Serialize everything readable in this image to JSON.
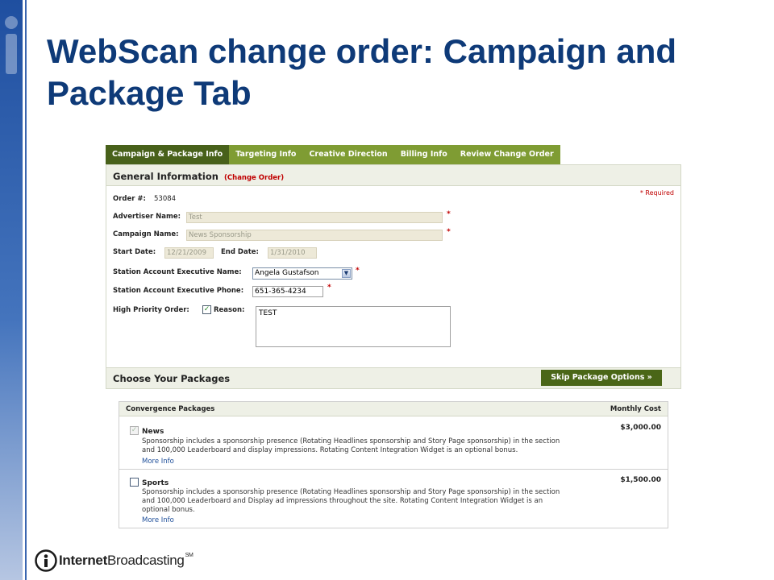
{
  "slide": {
    "title": "WebScan change order: Campaign and Package Tab"
  },
  "tabs": [
    {
      "label": "Campaign & Package Info",
      "active": true
    },
    {
      "label": "Targeting Info"
    },
    {
      "label": "Creative Direction"
    },
    {
      "label": "Billing Info"
    },
    {
      "label": "Review Change Order"
    }
  ],
  "general": {
    "title": "General Information",
    "subtitle": "(Change Order)",
    "required_note": "* Required",
    "order_label": "Order #:",
    "order_value": "53084",
    "advertiser_label": "Advertiser Name:",
    "advertiser_value": "Test",
    "campaign_label": "Campaign Name:",
    "campaign_value": "News Sponsorship",
    "start_label": "Start Date:",
    "start_value": "12/21/2009",
    "end_label": "End Date:",
    "end_value": "1/31/2010",
    "sae_name_label": "Station Account Executive Name:",
    "sae_name_value": "Angela Gustafson",
    "sae_phone_label": "Station Account Executive Phone:",
    "sae_phone_value": "651-365-4234",
    "priority_label": "High Priority Order:",
    "priority_checked": true,
    "reason_label": "Reason:",
    "reason_value": "TEST",
    "required_mark": "*"
  },
  "packages": {
    "title": "Choose Your Packages",
    "skip_button": "Skip Package Options »",
    "table_header_left": "Convergence Packages",
    "table_header_right": "Monthly Cost",
    "rows": [
      {
        "name": "News",
        "checked": true,
        "disabled": true,
        "description_line1": "Sponsorship includes a sponsorship presence (Rotating Headlines sponsorship and Story Page sponsorship) in the section",
        "description_line2": "and 100,000 Leaderboard and display impressions. Rotating Content Integration Widget is an optional bonus.",
        "more": "More Info",
        "cost": "$3,000.00"
      },
      {
        "name": "Sports",
        "checked": false,
        "description_line1": "Sponsorship includes a sponsorship presence (Rotating Headlines sponsorship and Story Page sponsorship) in the section",
        "description_line2": "and 100,000 Leaderboard and Display ad impressions throughout the site. Rotating Content Integration Widget is an",
        "description_line3": "optional bonus.",
        "more": "More Info",
        "cost": "$1,500.00"
      }
    ]
  },
  "footer": {
    "logo_bold": "Internet",
    "logo_regular": "Broadcasting",
    "logo_mark": "SM"
  },
  "colors": {
    "title_blue": "#0e3a78",
    "tab_green": "#7f9c33",
    "tab_active": "#48611a",
    "required_red": "#c00000"
  }
}
